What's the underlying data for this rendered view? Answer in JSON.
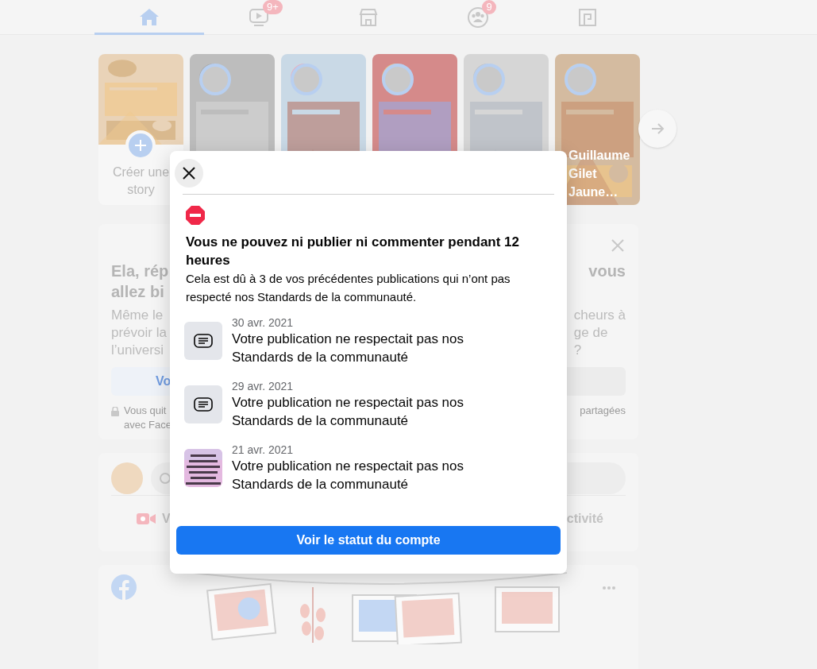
{
  "nav": {
    "tabs": [
      {
        "selected": true
      },
      {
        "selected": false,
        "badge": "9+"
      },
      {
        "selected": false
      },
      {
        "selected": false,
        "badge": "9"
      },
      {
        "selected": false
      }
    ]
  },
  "stories": [
    {
      "kind": "create",
      "label": "Créer une story"
    },
    {
      "kind": "story"
    },
    {
      "kind": "story"
    },
    {
      "kind": "story"
    },
    {
      "kind": "story"
    },
    {
      "kind": "story",
      "name": "Guillaume Gilet Jaune…"
    }
  ],
  "prompt_card": {
    "title_left": [
      "Ela, rép",
      "allez bi"
    ],
    "title_right": [
      "vous"
    ],
    "body_left": [
      "Même le",
      "prévoir la",
      "l’universi"
    ],
    "body_right": [
      "cheurs à",
      "ge de",
      "?"
    ],
    "button_left": "Vo",
    "footer_left": [
      "Vous quit",
      "avec Face"
    ],
    "footer_right": "partagées"
  },
  "composer": {
    "action_left": "V",
    "action_right": "ctivité"
  },
  "modal": {
    "title": "Vous ne pouvez ni publier ni commenter pendant 12 heures",
    "body": "Cela est dû à 3 de vos précédentes publications qui n’ont pas respecté nos Standards de la communauté.",
    "items": [
      {
        "kind": "post",
        "date": "30 avr. 2021",
        "text": "Votre publication ne respectait pas nos Standards de la communauté"
      },
      {
        "kind": "post",
        "date": "29 avr. 2021",
        "text": "Votre publication ne respectait pas nos Standards de la communauté"
      },
      {
        "kind": "picture",
        "date": "21 avr. 2021",
        "text": "Votre publication ne respectait pas nos Standards de la communauté"
      }
    ],
    "button": "Voir le statut du compte"
  }
}
